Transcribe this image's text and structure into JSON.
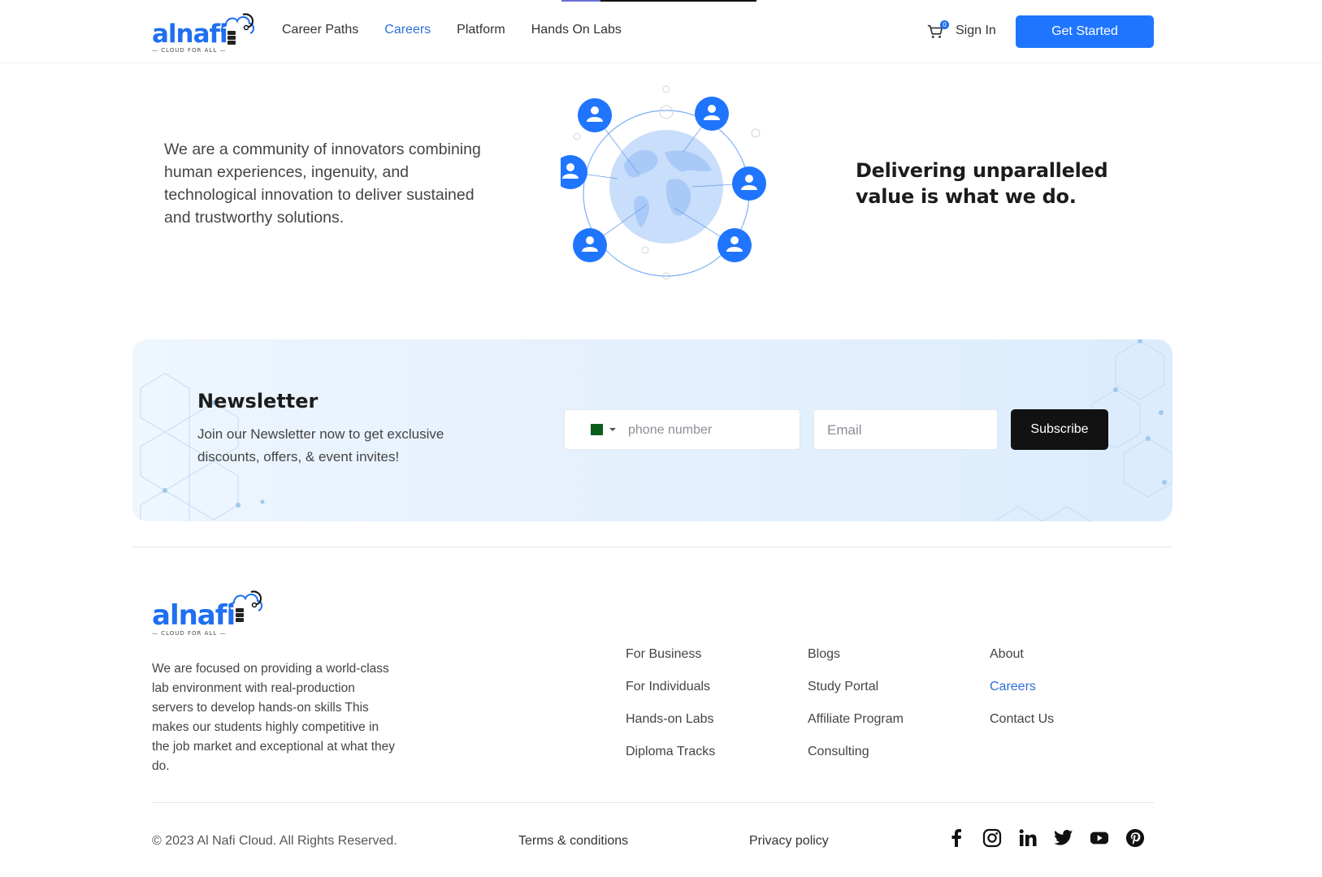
{
  "brand": {
    "name": "alnafi",
    "tagline": "— CLOUD FOR ALL —",
    "accent": "#1f75fe"
  },
  "nav": {
    "items": [
      {
        "label": "Career Paths",
        "active": false
      },
      {
        "label": "Careers",
        "active": true
      },
      {
        "label": "Platform",
        "active": false
      },
      {
        "label": "Hands On Labs",
        "active": false
      }
    ],
    "cart_count": "0",
    "sign_in": "Sign In",
    "get_started": "Get Started"
  },
  "hero": {
    "text": "We are a community of innovators combining human experiences, ingenuity, and technological innovation to deliver sustained and trustworthy solutions.",
    "heading": "Delivering unparalleled value is what we do."
  },
  "newsletter": {
    "title": "Newsletter",
    "subtitle": "Join our Newsletter now to get exclusive discounts, offers, & event invites!",
    "phone_placeholder": "phone number",
    "email_placeholder": "Email",
    "subscribe": "Subscribe"
  },
  "footer": {
    "about": "We are focused on providing a world-class lab environment with real-production servers to develop hands-on skills This makes our students highly competitive in the job market and exceptional at what they do.",
    "col1": [
      "For Business",
      "For Individuals",
      "Hands-on Labs",
      "Diploma Tracks"
    ],
    "col2": [
      "Blogs",
      "Study Portal",
      "Affiliate Program",
      "Consulting"
    ],
    "col3": [
      "About",
      "Careers",
      "Contact Us"
    ],
    "copyright": "© 2023 Al Nafi Cloud. All Rights Reserved.",
    "terms": "Terms & conditions",
    "privacy": "Privacy policy",
    "socials": [
      "facebook-icon",
      "instagram-icon",
      "linkedin-icon",
      "twitter-icon",
      "youtube-icon",
      "pinterest-icon"
    ]
  }
}
